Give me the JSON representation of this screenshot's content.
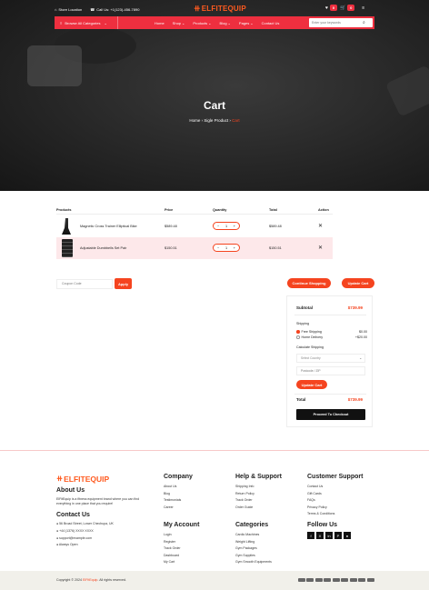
{
  "topbar": {
    "store_locator": "Store Location",
    "call_us": "Call Us: +1(123)-456-7890",
    "cart_count": "0",
    "wishlist_count": "0"
  },
  "brand": {
    "logo_text": "ELFITEQUIP",
    "accent": "#ee2f3f",
    "orange": "#f5441f"
  },
  "nav": {
    "categories_label": "Browse All Categories",
    "items": [
      {
        "label": "Home"
      },
      {
        "label": "Shop"
      },
      {
        "label": "Products"
      },
      {
        "label": "Blog"
      },
      {
        "label": "Pages"
      },
      {
        "label": "Contact Us"
      }
    ],
    "search_placeholder": "Enter your keywords"
  },
  "hero": {
    "title": "Cart",
    "crumb_home": "Home",
    "crumb_mid": "Sigle Product",
    "crumb_current": "Cart"
  },
  "cart_table": {
    "headers": [
      "Products",
      "Price",
      "Quantity",
      "Total",
      "Action"
    ],
    "rows": [
      {
        "name": "Magnetic Cross Trainer Elliptical Bike",
        "price": "$589.48",
        "qty": "1",
        "total": "$589.48"
      },
      {
        "name": "Adjustable Dumbbells Set Pair",
        "price": "$150.51",
        "qty": "1",
        "total": "$150.51"
      }
    ]
  },
  "coupon": {
    "placeholder": "Coupon Code",
    "apply": "Apply"
  },
  "actions": {
    "continue": "Continue Shopping",
    "update": "Update Cart"
  },
  "summary": {
    "subtotal_label": "Subtotal",
    "subtotal_value": "$739.99",
    "shipping_label": "Shipping",
    "options": [
      {
        "label": "Free Shipping",
        "value": "$0.00"
      },
      {
        "label": "Home Delivery",
        "value": "+$20.00"
      }
    ],
    "calc_label": "Calculate Shipping",
    "country_placeholder": "Select Country",
    "zip_placeholder": "Postcode / ZIP",
    "update_btn": "Update Cart",
    "total_label": "Total",
    "total_value": "$739.99",
    "checkout_btn": "Proceed To Checkout"
  },
  "footer": {
    "about_title": "About Us",
    "about_text": "ElFitEquip is a fitness equipment brand where you can find everything in one place that you require!",
    "contact_title": "Contact Us",
    "contacts": [
      "56 Broad Street, Lower Chechupa, UK",
      "+44 (1376) XXXX XXXX",
      "support@example.com",
      "Always Open"
    ],
    "company_title": "Company",
    "company": [
      "About Us",
      "Blog",
      "Testimonials",
      "Career"
    ],
    "account_title": "My Account",
    "account": [
      "Login",
      "Register",
      "Track Order",
      "Dashboard",
      "My Cart"
    ],
    "help_title": "Help & Support",
    "help": [
      "Shipping Info",
      "Return Policy",
      "Track Order",
      "Order Guide"
    ],
    "categories_title": "Categories",
    "categories": [
      "Cardio Machines",
      "Weight Lifting",
      "Gym Packages",
      "Gym Supplies",
      "Gym Smooth Equipments"
    ],
    "support_title": "Customer Support",
    "support": [
      "Contact Us",
      "Gift Cards",
      "FAQs",
      "Privacy Policy",
      "Terms & Conditions"
    ],
    "follow_title": "Follow Us",
    "social": [
      "f",
      "X",
      "in",
      "P",
      "●"
    ],
    "copyright_pre": "Copyright © 2024 ",
    "copyright_brand": "ElFitEquip",
    "copyright_post": ". All rights reserved."
  }
}
